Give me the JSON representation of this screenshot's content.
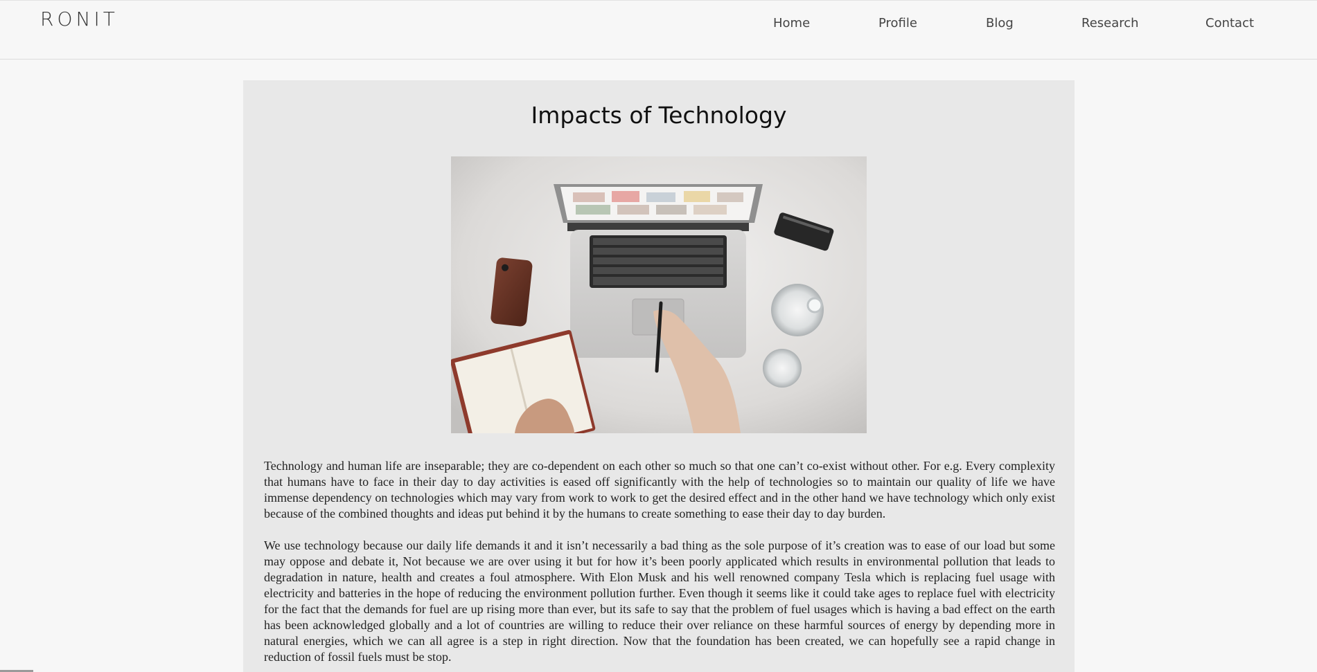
{
  "site": {
    "logo": "RONIT"
  },
  "nav": {
    "items": [
      {
        "label": "Home"
      },
      {
        "label": "Profile"
      },
      {
        "label": "Blog"
      },
      {
        "label": "Research"
      },
      {
        "label": "Contact"
      }
    ]
  },
  "article": {
    "title": "Impacts of Technology",
    "paragraphs": [
      "Technology and human life are inseparable; they are co-dependent on each other so much so that one can’t co-exist without other. For e.g. Every complexity that humans have to face in their day to day activities is eased off significantly with the help of technologies so to maintain our quality of life we have immense dependency on technologies which may vary from work to work to get the desired effect and in the other hand we have technology which only exist because of the combined thoughts and ideas put behind it by the humans to create something to ease their day to day burden.",
      "We use technology because our daily life demands it and it isn’t necessarily a bad thing as the sole purpose of it’s creation was to ease of our load but some may oppose and debate it, Not because we are over using it but for how it’s been poorly applicated which results in environmental pollution that leads to degradation in nature, health and creates a foul atmosphere. With Elon Musk and his well renowned company Tesla which is replacing fuel usage with electricity and batteries in the hope of reducing the environment pollution further. Even though it seems like it could take ages to replace fuel with electricity for the fact that the demands for fuel are up rising more than ever, but its safe to say that the problem of fuel usages which is having a bad effect on the earth has been acknowledged globally and a lot of countries are willing to reduce their over reliance on these harmful sources of energy by depending more in natural energies, which we can all agree is a step in right direction. Now that the foundation has been created, we can hopefully see a rapid change in reduction of fossil fuels must be stop."
    ]
  },
  "colors": {
    "page_bg": "#f7f7f7",
    "card_bg": "#e8e8e8",
    "text": "#222222",
    "nav_text": "#444444"
  },
  "icons": {
    "hero": "laptop-desk-photo"
  }
}
